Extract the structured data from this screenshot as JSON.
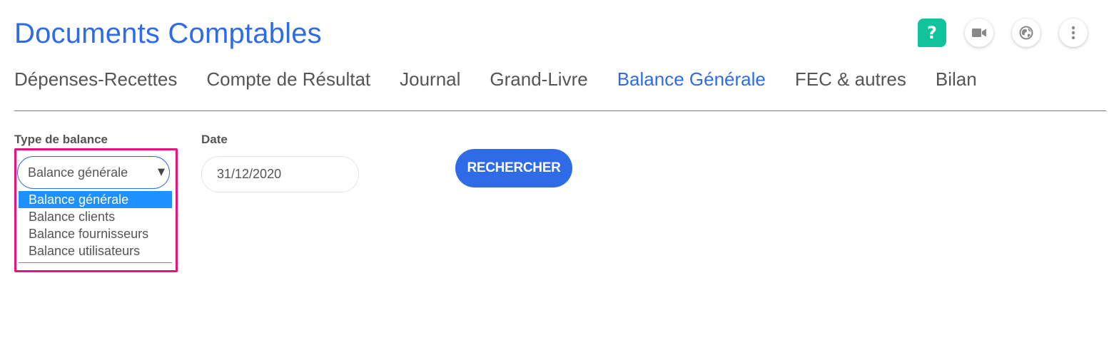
{
  "header": {
    "title": "Documents Comptables",
    "help_label": "?"
  },
  "tabs": [
    {
      "label": "Dépenses-Recettes",
      "active": false
    },
    {
      "label": "Compte de Résultat",
      "active": false
    },
    {
      "label": "Journal",
      "active": false
    },
    {
      "label": "Grand-Livre",
      "active": false
    },
    {
      "label": "Balance Générale",
      "active": true
    },
    {
      "label": "FEC & autres",
      "active": false
    },
    {
      "label": "Bilan",
      "active": false
    }
  ],
  "filters": {
    "type_label": "Type de balance",
    "type_value": "Balance générale",
    "type_options": [
      "Balance générale",
      "Balance clients",
      "Balance fournisseurs",
      "Balance utilisateurs"
    ],
    "date_label": "Date",
    "date_value": "31/12/2020",
    "search_label": "RECHERCHER"
  },
  "colors": {
    "accent": "#2f6be6",
    "help": "#12c29a",
    "highlight": "#e8147e",
    "selected_option": "#1e90ff"
  },
  "icons": [
    "help-icon",
    "video-camera-icon",
    "globe-icon",
    "more-vertical-icon"
  ]
}
